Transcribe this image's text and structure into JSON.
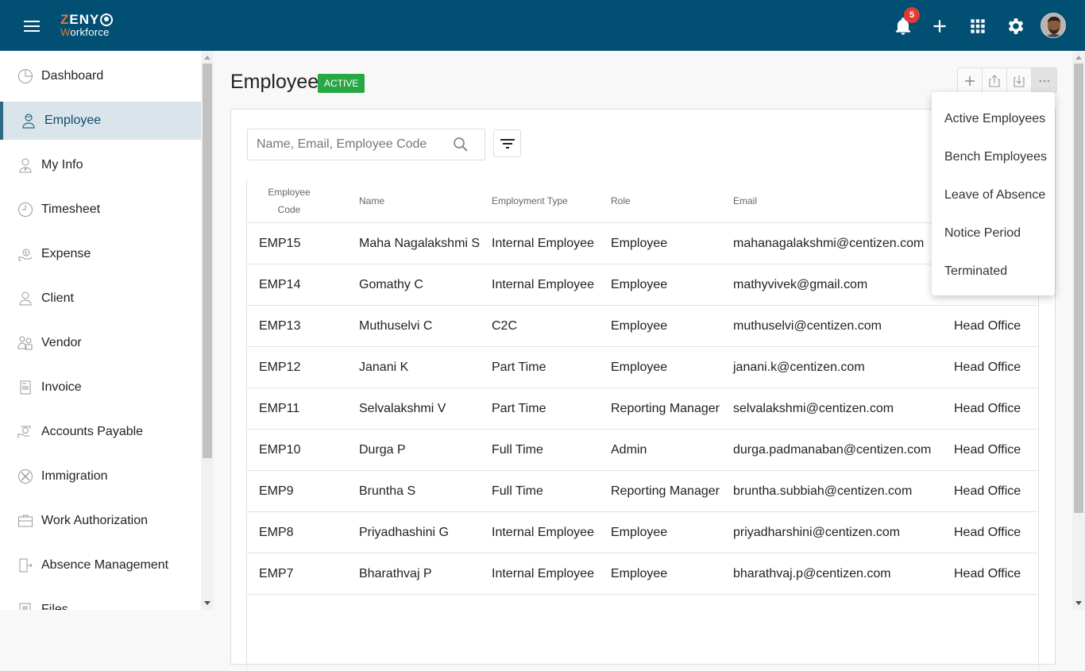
{
  "app": {
    "logo_line1_first": "Z",
    "logo_line1_rest": "ENY",
    "logo_line2_first": "W",
    "logo_line2_rest": "orkforce",
    "notification_count": "5"
  },
  "sidebar": {
    "items": [
      {
        "label": "Dashboard",
        "icon": "dashboard-icon"
      },
      {
        "label": "Employee",
        "icon": "employee-icon",
        "active": true
      },
      {
        "label": "My Info",
        "icon": "my-info-icon"
      },
      {
        "label": "Timesheet",
        "icon": "timesheet-icon"
      },
      {
        "label": "Expense",
        "icon": "expense-icon"
      },
      {
        "label": "Client",
        "icon": "client-icon"
      },
      {
        "label": "Vendor",
        "icon": "vendor-icon"
      },
      {
        "label": "Invoice",
        "icon": "invoice-icon"
      },
      {
        "label": "Accounts Payable",
        "icon": "accounts-payable-icon"
      },
      {
        "label": "Immigration",
        "icon": "immigration-icon"
      },
      {
        "label": "Work Authorization",
        "icon": "work-authorization-icon"
      },
      {
        "label": "Absence Management",
        "icon": "absence-management-icon"
      },
      {
        "label": "Files",
        "icon": "files-icon"
      }
    ]
  },
  "page": {
    "title": "Employee",
    "status_badge": "ACTIVE",
    "search_placeholder": "Name, Email, Employee Code",
    "search_value": ""
  },
  "toolbar": {
    "buttons": [
      "add-icon",
      "export-icon",
      "import-icon",
      "more-icon"
    ]
  },
  "dropdown": {
    "items": [
      "Active Employees",
      "Bench Employees",
      "Leave of Absence",
      "Notice Period",
      "Terminated"
    ]
  },
  "table": {
    "headers": {
      "code_line1": "Employee",
      "code_line2": "Code",
      "name": "Name",
      "type": "Employment Type",
      "role": "Role",
      "email": "Email"
    },
    "rows": [
      {
        "code": "EMP15",
        "name": "Maha Nagalakshmi S",
        "type": "Internal Employee",
        "role": "Employee",
        "email": "mahanagalakshmi@centizen.com",
        "location": ""
      },
      {
        "code": "EMP14",
        "name": "Gomathy C",
        "type": "Internal Employee",
        "role": "Employee",
        "email": "mathyvivek@gmail.com",
        "location": ""
      },
      {
        "code": "EMP13",
        "name": "Muthuselvi C",
        "type": "C2C",
        "role": "Employee",
        "email": "muthuselvi@centizen.com",
        "location": "Head Office"
      },
      {
        "code": "EMP12",
        "name": "Janani K",
        "type": "Part Time",
        "role": "Employee",
        "email": "janani.k@centizen.com",
        "location": "Head Office"
      },
      {
        "code": "EMP11",
        "name": "Selvalakshmi V",
        "type": "Part Time",
        "role": "Reporting Manager",
        "email": "selvalakshmi@centizen.com",
        "location": "Head Office"
      },
      {
        "code": "EMP10",
        "name": "Durga P",
        "type": "Full Time",
        "role": "Admin",
        "email": "durga.padmanaban@centizen.com",
        "location": "Head Office"
      },
      {
        "code": "EMP9",
        "name": "Bruntha S",
        "type": "Full Time",
        "role": "Reporting Manager",
        "email": "bruntha.subbiah@centizen.com",
        "location": "Head Office"
      },
      {
        "code": "EMP8",
        "name": "Priyadhashini G",
        "type": "Internal Employee",
        "role": "Employee",
        "email": "priyadharshini@centizen.com",
        "location": "Head Office"
      },
      {
        "code": "EMP7",
        "name": "Bharathvaj P",
        "type": "Internal Employee",
        "role": "Employee",
        "email": "bharathvaj.p@centizen.com",
        "location": "Head Office"
      }
    ]
  },
  "colors": {
    "topbar": "#014f73",
    "accent_orange": "#e8772e",
    "active_badge": "#28a745",
    "notification_badge": "#e53935",
    "sidebar_active_bg": "#d9e4eb"
  }
}
